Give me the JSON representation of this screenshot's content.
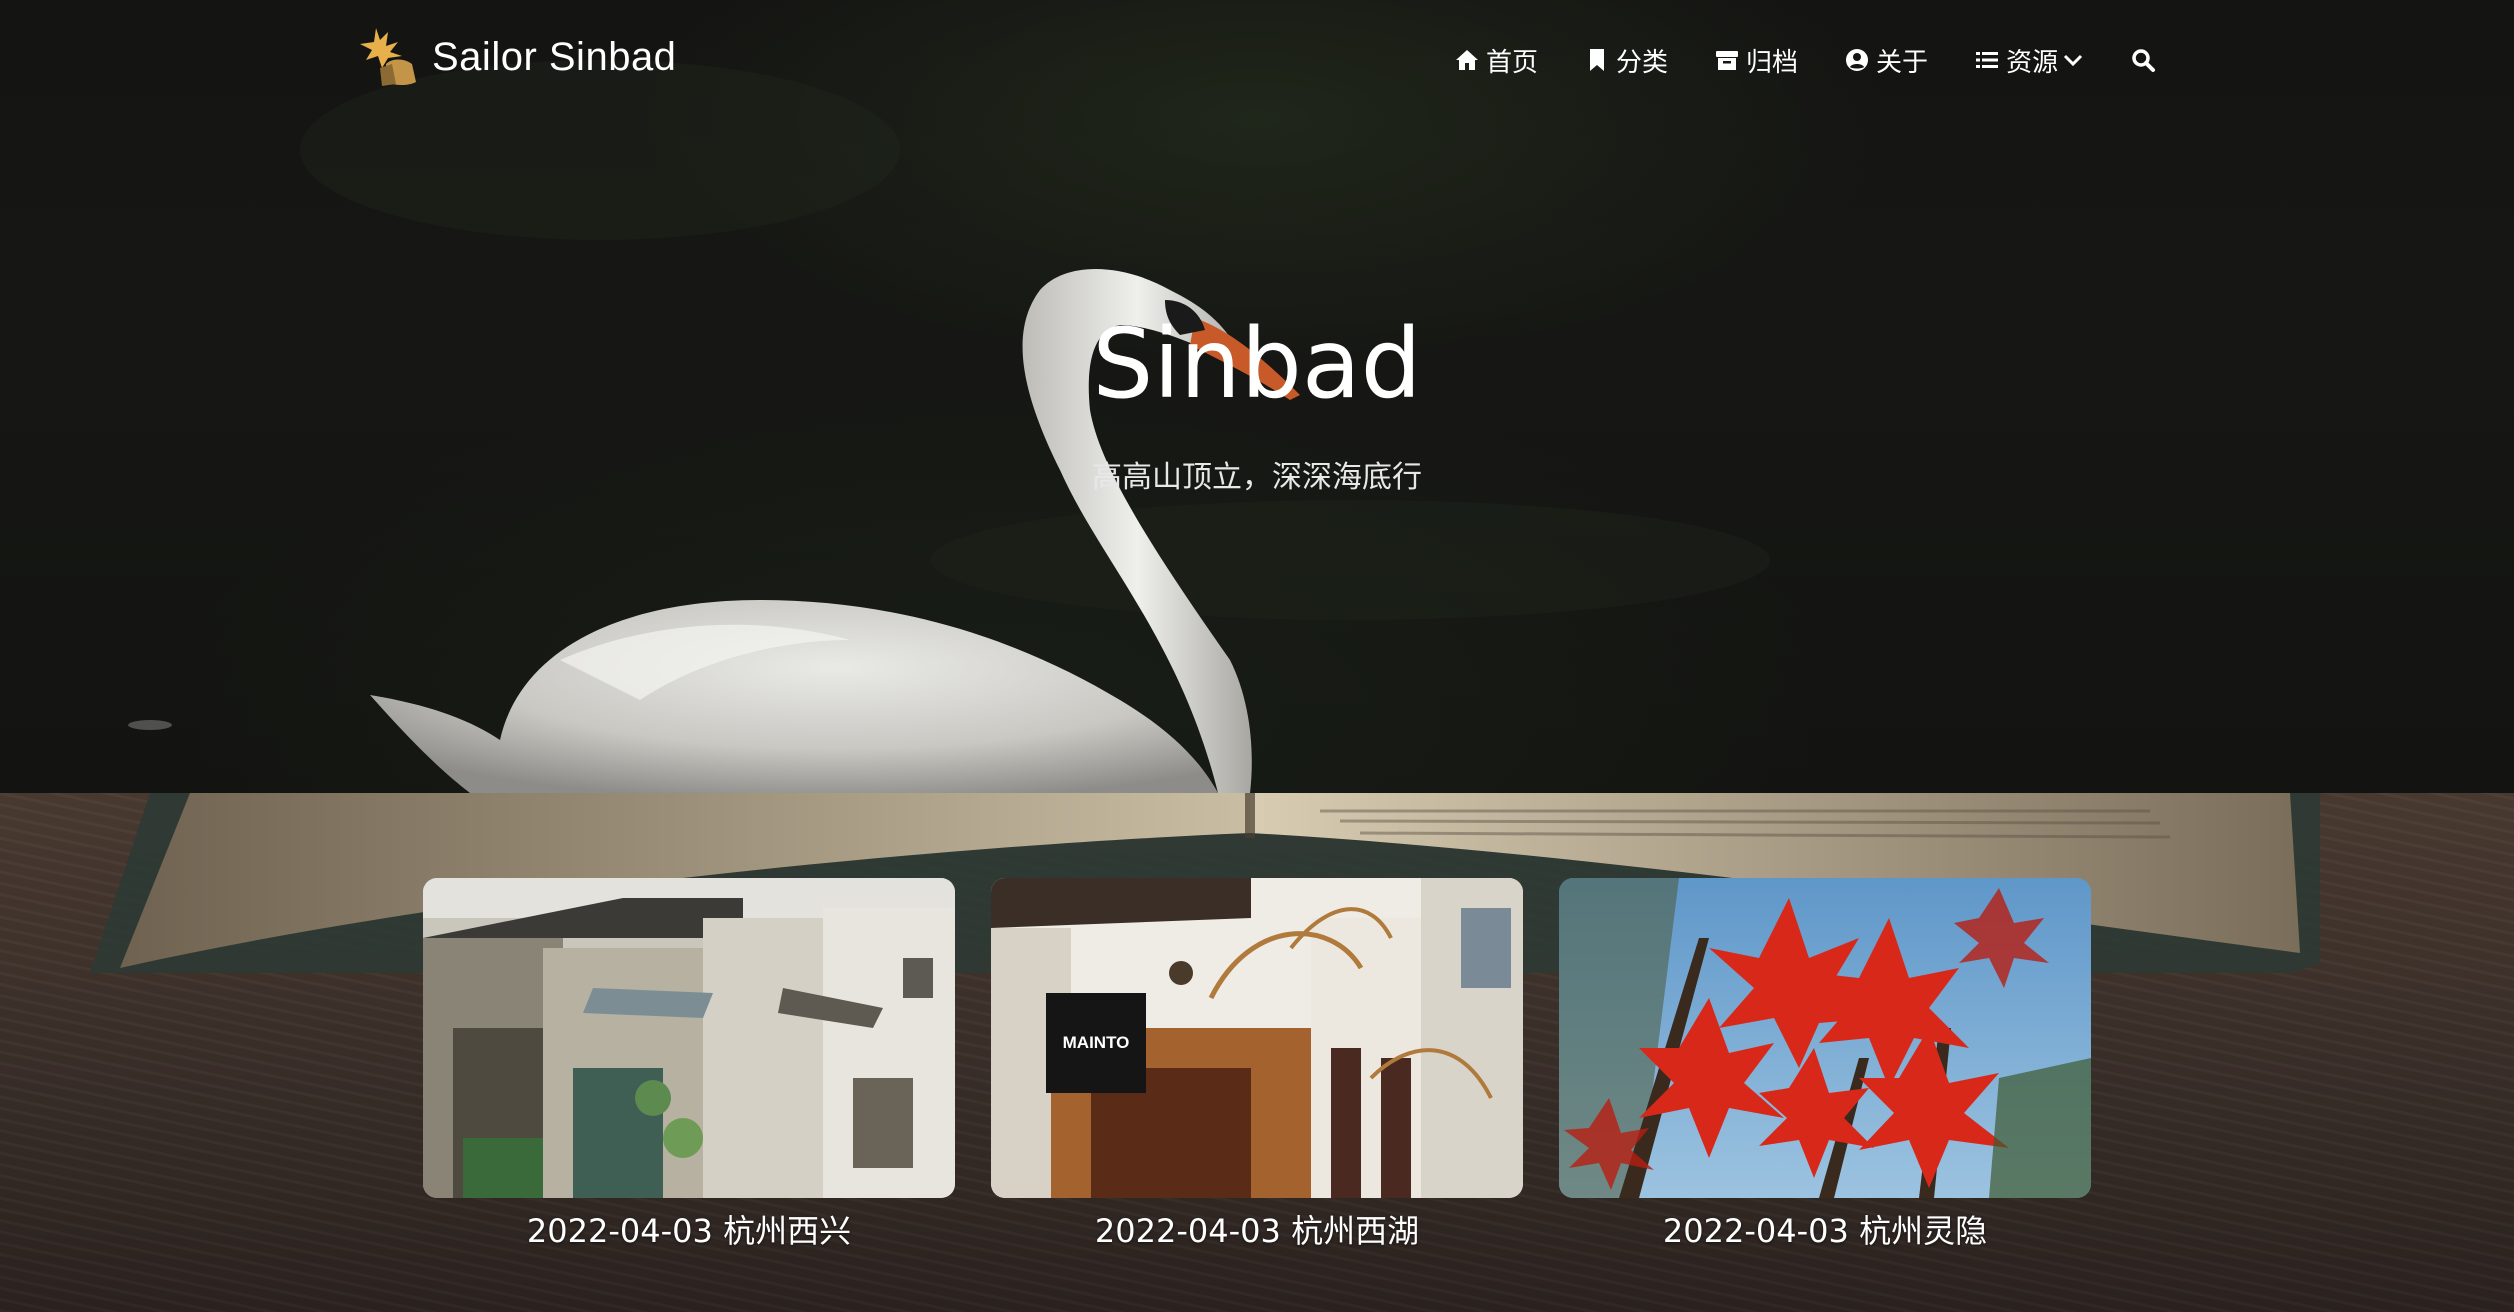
{
  "site": {
    "brand_name": "Sailor Sinbad"
  },
  "nav": {
    "items": [
      {
        "label": "首页",
        "icon": "home-icon"
      },
      {
        "label": "分类",
        "icon": "bookmark-icon"
      },
      {
        "label": "归档",
        "icon": "archive-icon"
      },
      {
        "label": "关于",
        "icon": "user-circle-icon"
      },
      {
        "label": "资源",
        "icon": "list-icon"
      }
    ],
    "search_icon": "search-icon"
  },
  "hero": {
    "title": "Sinbad",
    "subtitle": "高高山顶立，深深海底行"
  },
  "cards": [
    {
      "caption": "2022-04-03 杭州西兴"
    },
    {
      "caption": "2022-04-03 杭州西湖"
    },
    {
      "caption": "2022-04-03 杭州灵隐"
    }
  ],
  "photo_text": {
    "shop_sign": "MAINTO"
  }
}
